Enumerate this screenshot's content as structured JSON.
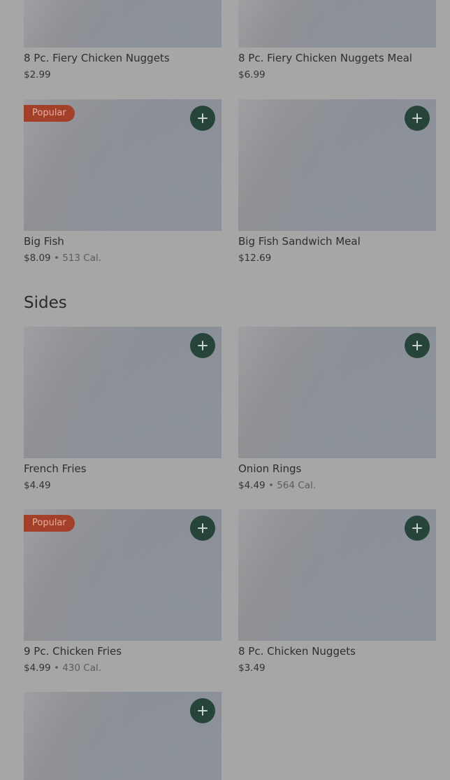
{
  "top_row": [
    {
      "name": "8 Pc. Fiery Chicken Nuggets",
      "price": "$2.99"
    },
    {
      "name": "8 Pc. Fiery Chicken Nuggets Meal",
      "price": "$6.99"
    }
  ],
  "row2": [
    {
      "badge": "Popular",
      "name": "Big Fish",
      "price": "$8.09",
      "cal": "513 Cal."
    },
    {
      "name": "Big Fish Sandwich Meal",
      "price": "$12.69"
    }
  ],
  "sides": {
    "title": "Sides",
    "items": [
      {
        "name": "French Fries",
        "price": "$4.49"
      },
      {
        "name": "Onion Rings",
        "price": "$4.49",
        "cal": "564 Cal."
      },
      {
        "badge": "Popular",
        "name": "9 Pc. Chicken Fries",
        "price": "$4.99",
        "cal": "430 Cal."
      },
      {
        "name": "8 Pc. Chicken Nuggets",
        "price": "$3.49"
      }
    ]
  },
  "separator": " • ",
  "colors": {
    "overlay": "#a6a6a6",
    "add_button": "#27443a",
    "badge": "#a2402a"
  },
  "icons": {
    "add": "plus-icon"
  }
}
